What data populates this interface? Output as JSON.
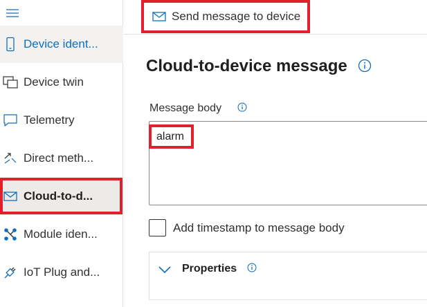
{
  "sidebar": {
    "menu_icon": "hamburger-icon",
    "items": [
      {
        "label": "Device ident...",
        "icon": "device-icon"
      },
      {
        "label": "Device twin",
        "icon": "device-twin-icon"
      },
      {
        "label": "Telemetry",
        "icon": "chat-icon"
      },
      {
        "label": "Direct meth...",
        "icon": "direct-method-icon"
      },
      {
        "label": "Cloud-to-d...",
        "icon": "mail-icon"
      },
      {
        "label": "Module iden...",
        "icon": "module-icon"
      },
      {
        "label": "IoT Plug and...",
        "icon": "plug-icon"
      }
    ]
  },
  "toolbar": {
    "send_label": "Send message to device",
    "send_icon": "mail-icon"
  },
  "main": {
    "title": "Cloud-to-device message",
    "message_body_label": "Message body",
    "message_body_value": "alarm",
    "timestamp_label": "Add timestamp to message body",
    "timestamp_checked": false,
    "properties_label": "Properties"
  },
  "colors": {
    "accent": "#106ebe",
    "highlight": "#e0202b",
    "text": "#323130"
  }
}
